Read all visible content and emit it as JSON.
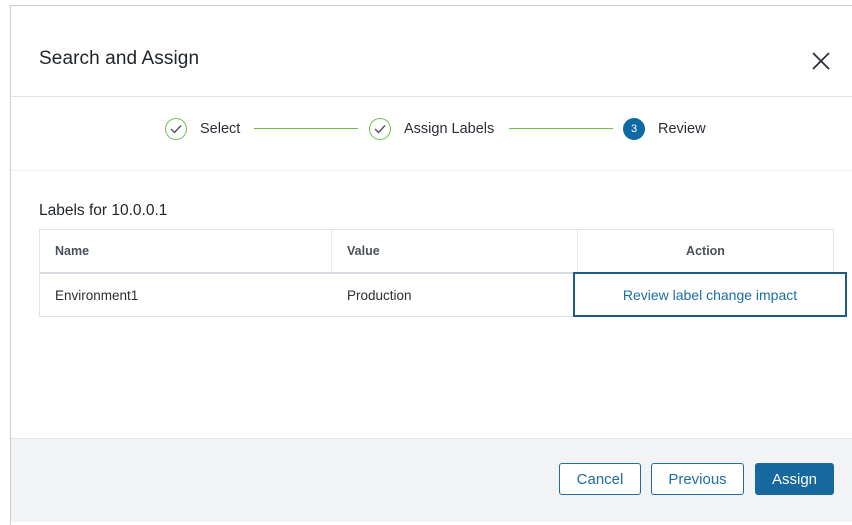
{
  "dialog": {
    "title": "Search and Assign"
  },
  "stepper": {
    "steps": [
      {
        "label": "Select",
        "state": "complete",
        "indicator": "check-icon"
      },
      {
        "label": "Assign Labels",
        "state": "complete",
        "indicator": "check-icon"
      },
      {
        "label": "Review",
        "state": "current",
        "indicator": "3"
      }
    ],
    "colors": {
      "complete": "#6cc04a",
      "current": "#0d6aa3"
    }
  },
  "section": {
    "title": "Labels for 10.0.0.1"
  },
  "table": {
    "columns": [
      "Name",
      "Value",
      "Action"
    ],
    "rows": [
      {
        "name": "Environment1",
        "value": "Production",
        "action": "Review label change impact"
      }
    ]
  },
  "footer": {
    "cancel_label": "Cancel",
    "previous_label": "Previous",
    "assign_label": "Assign"
  },
  "colors": {
    "accent": "#16689f",
    "link": "#1a6ea8"
  }
}
